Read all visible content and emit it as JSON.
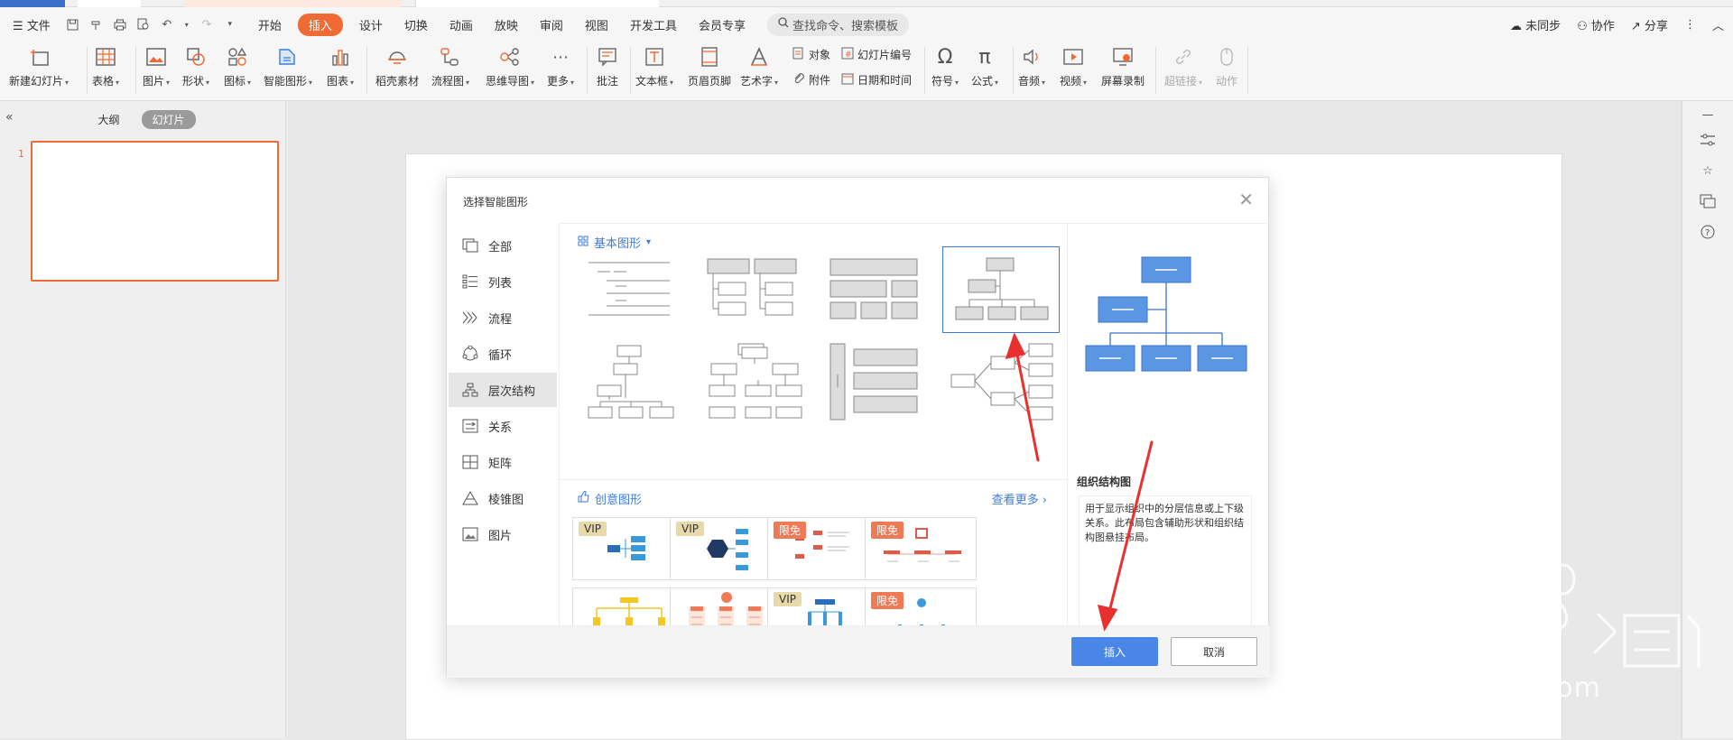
{
  "menubar": {
    "file": "文件",
    "tabs": [
      "开始",
      "插入",
      "设计",
      "切换",
      "动画",
      "放映",
      "审阅",
      "视图",
      "开发工具",
      "会员专享"
    ],
    "active_tab": "插入",
    "search_placeholder": "查找命令、搜索模板",
    "sync": "未同步",
    "collab": "协作",
    "share": "分享"
  },
  "ribbon": {
    "new_slide": "新建幻灯片",
    "table": "表格",
    "picture": "图片",
    "shape": "形状",
    "icon": "图标",
    "smartart": "智能图形",
    "chart": "图表",
    "material": "稻壳素材",
    "flowchart": "流程图",
    "mindmap": "思维导图",
    "more": "更多",
    "comment": "批注",
    "textbox": "文本框",
    "header_footer": "页眉页脚",
    "wordart": "艺术字",
    "object": "对象",
    "slide_number": "幻灯片编号",
    "attachment": "附件",
    "datetime": "日期和时间",
    "symbol": "符号",
    "formula": "公式",
    "audio": "音频",
    "video": "视频",
    "screen_record": "屏幕录制",
    "hyperlink": "超链接",
    "action": "动作"
  },
  "left_pane": {
    "tab_outline": "大纲",
    "tab_slides": "幻灯片",
    "slide_number": "1"
  },
  "dialog": {
    "title": "选择智能图形",
    "categories": [
      "全部",
      "列表",
      "流程",
      "循环",
      "层次结构",
      "关系",
      "矩阵",
      "棱锥图",
      "图片"
    ],
    "active_category": "层次结构",
    "basic_section": "基本图形",
    "creative_section": "创意图形",
    "see_more": "查看更多",
    "badge_vip": "VIP",
    "badge_free": "限免",
    "preview_name": "组织结构图",
    "preview_desc": "用于显示组织中的分层信息或上下级关系。此布局包含辅助形状和组织结构图悬挂布局。",
    "insert_button": "插入",
    "cancel_button": "取消"
  },
  "colors": {
    "accent": "#f06a35",
    "primary_button": "#4a86e8",
    "link": "#3b7be0",
    "annotation": "#e8312f"
  }
}
